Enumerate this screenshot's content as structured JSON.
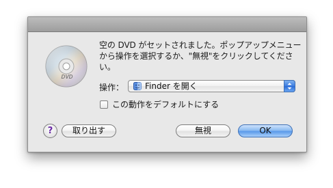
{
  "dialog": {
    "message": "空の DVD がセットされました。ポップアップメニューから操作を選択するか、\"無視\"をクリックしてください。",
    "disc_icon": "dvd-disc-icon",
    "disc_label": "DVD",
    "action_label": "操作：",
    "action_select": {
      "selected": "Finder を開く",
      "icon": "finder-icon"
    },
    "default_checkbox": {
      "label": "この動作をデフォルトにする",
      "checked": false
    },
    "buttons": {
      "help": "?",
      "eject": "取り出す",
      "ignore": "無視",
      "ok": "OK"
    }
  }
}
